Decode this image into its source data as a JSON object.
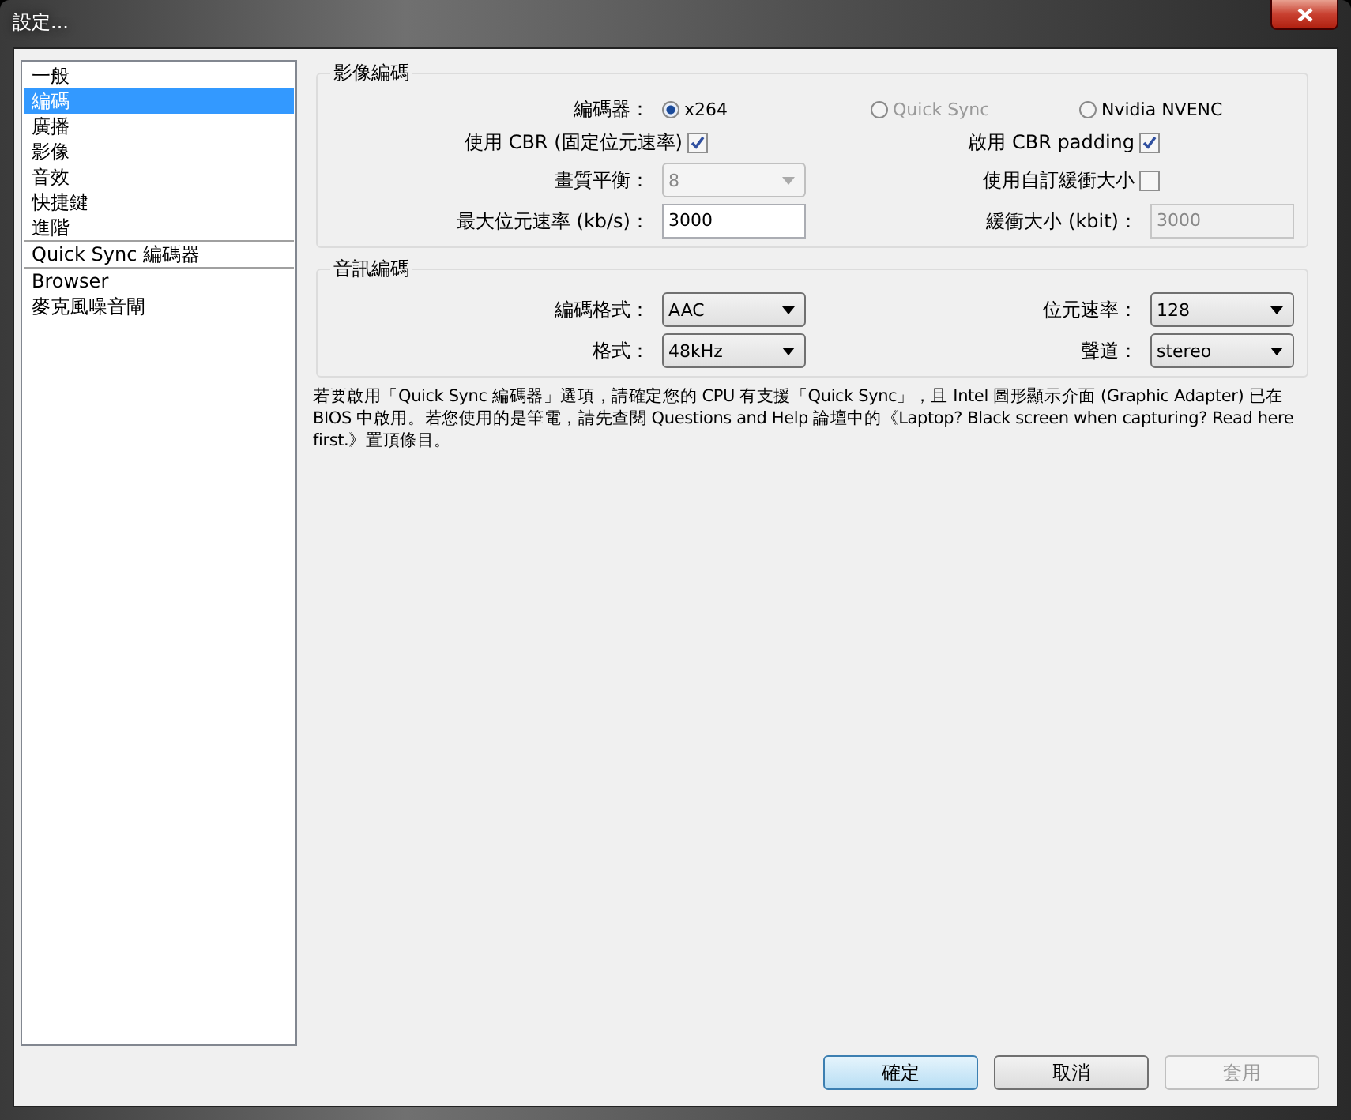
{
  "window": {
    "title": "設定..."
  },
  "sidebar": {
    "groups": [
      [
        {
          "label": "一般",
          "selected": false
        },
        {
          "label": "編碼",
          "selected": true
        },
        {
          "label": "廣播",
          "selected": false
        },
        {
          "label": "影像",
          "selected": false
        },
        {
          "label": "音效",
          "selected": false
        },
        {
          "label": "快捷鍵",
          "selected": false
        },
        {
          "label": "進階",
          "selected": false
        }
      ],
      [
        {
          "label": "Quick Sync 編碼器",
          "selected": false
        }
      ],
      [
        {
          "label": "Browser",
          "selected": false
        },
        {
          "label": "麥克風噪音閘",
          "selected": false
        }
      ]
    ]
  },
  "video": {
    "title": "影像編碼",
    "encoder": {
      "label": "編碼器：",
      "options": [
        {
          "label": "x264",
          "selected": true,
          "disabled": false
        },
        {
          "label": "Quick Sync",
          "selected": false,
          "disabled": true
        },
        {
          "label": "Nvidia NVENC",
          "selected": false,
          "disabled": false
        }
      ]
    },
    "cbr": {
      "label": "使用 CBR (固定位元速率)",
      "checked": true
    },
    "cbr_padding": {
      "label": "啟用 CBR padding",
      "checked": true
    },
    "quality": {
      "label": "畫質平衡：",
      "value": "8",
      "disabled": true
    },
    "custom_buffer": {
      "label": "使用自訂緩衝大小",
      "checked": false
    },
    "max_bitrate": {
      "label": "最大位元速率 (kb/s)：",
      "value": "3000",
      "disabled": false
    },
    "buffer_size": {
      "label": "緩衝大小 (kbit)：",
      "value": "3000",
      "disabled": true
    }
  },
  "audio": {
    "title": "音訊編碼",
    "codec": {
      "label": "編碼格式：",
      "value": "AAC"
    },
    "bitrate": {
      "label": "位元速率：",
      "value": "128"
    },
    "format": {
      "label": "格式：",
      "value": "48kHz"
    },
    "channels": {
      "label": "聲道：",
      "value": "stereo"
    }
  },
  "note": "若要啟用「Quick Sync 編碼器」選項，請確定您的 CPU 有支援「Quick Sync」，且 Intel 圖形顯示介面 (Graphic Adapter) 已在 BIOS 中啟用。若您使用的是筆電，請先查閱 Questions and Help 論壇中的《Laptop? Black screen when capturing? Read here first.》置頂條目。",
  "buttons": [
    {
      "label": "確定",
      "kind": "default",
      "disabled": false
    },
    {
      "label": "取消",
      "kind": "normal",
      "disabled": false
    },
    {
      "label": "套用",
      "kind": "normal",
      "disabled": true
    }
  ]
}
